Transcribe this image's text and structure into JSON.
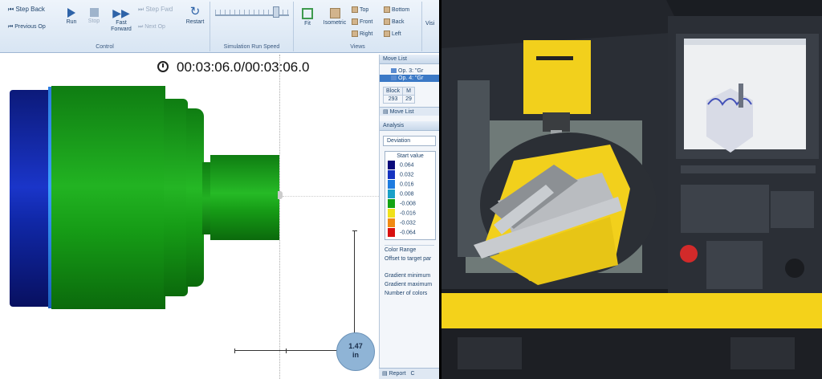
{
  "ribbon": {
    "control": {
      "step_back": "Step Back",
      "previous_op": "Previous Op",
      "run": "Run",
      "stop": "Stop",
      "fast_forward_line1": "Fast",
      "fast_forward_line2": "Forward",
      "step_fwd": "Step Fwd",
      "next_op": "Next Op",
      "restart": "Restart",
      "group_label": "Control"
    },
    "speed": {
      "group_label": "Simulation Run Speed"
    },
    "views": {
      "fit": "Fit",
      "isometric": "Isometric",
      "top": "Top",
      "front": "Front",
      "right": "Right",
      "bottom": "Bottom",
      "back": "Back",
      "left": "Left",
      "group_label": "Views"
    },
    "cut_label": "Visi"
  },
  "timer": "00:03:06.0/00:03:06.0",
  "measurement": {
    "value": "1.47",
    "unit": "in"
  },
  "move_list": {
    "title": "Move List",
    "items": [
      "Op. 3: \"Gr",
      "Op. 4: \"Gr"
    ],
    "table_headers": [
      "Block",
      "M"
    ],
    "table_values": [
      "293",
      "29"
    ],
    "tab_label": "Move List"
  },
  "analysis": {
    "title": "Analysis",
    "mode": "Deviation",
    "legend_title": "Start value",
    "legend": [
      {
        "value": "0.064",
        "color": "#0a0a7a"
      },
      {
        "value": "0.032",
        "color": "#1533c0"
      },
      {
        "value": "0.016",
        "color": "#1d7be0"
      },
      {
        "value": "0.008",
        "color": "#1aa0c8"
      },
      {
        "value": "-0.008",
        "color": "#13a313"
      },
      {
        "value": "-0.016",
        "color": "#f0e11a"
      },
      {
        "value": "-0.032",
        "color": "#f08a12"
      },
      {
        "value": "-0.064",
        "color": "#d81010"
      }
    ],
    "color_range": "Color Range",
    "offset_label": "Offset to target par",
    "gradient_minimum": "Gradient minimum",
    "gradient_maximum": "Gradient maximum",
    "number_of_colors": "Number of colors"
  },
  "bottom_tabs": {
    "report": "Report",
    "extra": "C"
  },
  "colors": {
    "part_green": "#1b9f1b",
    "part_blue": "#1a35c9",
    "ribbon_bg": "#dbe7f4",
    "machine_yellow": "#f4d21a"
  }
}
